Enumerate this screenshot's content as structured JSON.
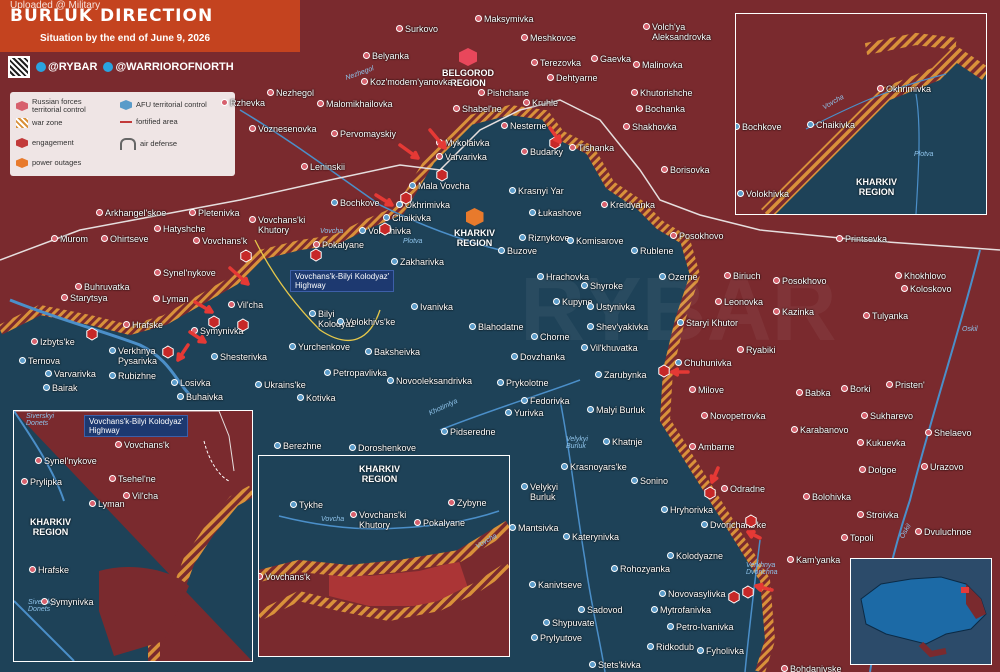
{
  "header": {
    "uploaded": "Uploaded @ Military",
    "title": "BURLUK DIRECTION",
    "subtitle": "Situation by the end of June 9, 2026",
    "handle1": "@RYBAR",
    "handle2": "@WARRIOROFNORTH"
  },
  "legend": {
    "ru_control": "Russian forces territorial control",
    "afu_control": "AFU territorial control",
    "war_zone": "war zone",
    "fortified": "fortified area",
    "engagement": "engagement",
    "air_defense": "air defense",
    "power": "power outages"
  },
  "regions": {
    "belgorod": "BELGOROD\nREGION",
    "kharkiv_main": "KHARKIV\nREGION",
    "kharkiv_inset_tr": "KHARKIV\nREGION",
    "kharkiv_inset_bl": "KHARKIV\nREGION",
    "kharkiv_inset_bm": "KHARKIV\nREGION"
  },
  "callouts": {
    "highway_main_1": "Vovchans'k-Bilyi Kolodyaz'",
    "highway_main_2": "Highway",
    "highway_inset_1": "Vovchans'k-Bilyi Kolodyaz'",
    "highway_inset_2": "Highway"
  },
  "rivers": {
    "nezhegol": "Nezhegol",
    "vovcha_main": "Vovcha",
    "plotva_main": "Plotva",
    "khotimlya": "Khotimlya",
    "velykyi_burluk_r": "Velykyi\nBurluk",
    "oskil": "Oskil",
    "oskil2": "Oskil",
    "verkhnya": "Verkhnya\nDvorichna",
    "siverskyi1": "Siverskyi\nDonets",
    "siverskyi2": "Siverskyi\nDonets",
    "vovcha_tr": "Vovcha",
    "plotva_tr": "Plotva",
    "vovcha_bm": "Vovcha",
    "vovcha_bm2": "Vovcha"
  },
  "towns_ru": [
    {
      "id": "surkovo",
      "name": "Surkovo"
    },
    {
      "id": "maksymivka",
      "name": "Maksymivka"
    },
    {
      "id": "meshkovoe",
      "name": "Meshkovoe"
    },
    {
      "id": "volchya",
      "name": "Volch'ya\nAleksandrovka"
    },
    {
      "id": "belyanka",
      "name": "Belyanka"
    },
    {
      "id": "terezovka",
      "name": "Terezovka"
    },
    {
      "id": "gaevka",
      "name": "Gaevka"
    },
    {
      "id": "malinovka",
      "name": "Malinovka"
    },
    {
      "id": "kozmod",
      "name": "Koz'modem'yanovka"
    },
    {
      "id": "dehtyarne",
      "name": "Dehtyarne"
    },
    {
      "id": "nezhegol_t",
      "name": "Nezhegol"
    },
    {
      "id": "malomikh",
      "name": "Malomikhailovka"
    },
    {
      "id": "pishchane",
      "name": "Pishchane"
    },
    {
      "id": "khutor",
      "name": "Khutorishche"
    },
    {
      "id": "rzhevka",
      "name": "Rzhevka"
    },
    {
      "id": "shabelne",
      "name": "Shabel'ne"
    },
    {
      "id": "kruhle",
      "name": "Kruhle"
    },
    {
      "id": "bochanka",
      "name": "Bochanka"
    },
    {
      "id": "voznes",
      "name": "Voznesenovka"
    },
    {
      "id": "shakhovka",
      "name": "Shakhovka"
    },
    {
      "id": "pervom",
      "name": "Pervomayskiy"
    },
    {
      "id": "mykolaivka",
      "name": "Mykolaivka"
    },
    {
      "id": "nesterne",
      "name": "Nesterne"
    },
    {
      "id": "varvarivka",
      "name": "Varvarivka"
    },
    {
      "id": "budarky",
      "name": "Budarky"
    },
    {
      "id": "tishanka",
      "name": "Tishanka"
    },
    {
      "id": "leninskii",
      "name": "Leninskii"
    },
    {
      "id": "borisovka",
      "name": "Borisovka"
    },
    {
      "id": "kreidyanka",
      "name": "Kreidyanka"
    },
    {
      "id": "arkhangel",
      "name": "Arkhangel'skoe"
    },
    {
      "id": "pletenivka",
      "name": "Pletenivka"
    },
    {
      "id": "hatyshche",
      "name": "Hatyshche"
    },
    {
      "id": "murom",
      "name": "Murom"
    },
    {
      "id": "ohirtseve",
      "name": "Ohirtseve"
    },
    {
      "id": "vovchansk",
      "name": "Vovchans'k"
    },
    {
      "id": "vovkhut",
      "name": "Vovchans'ki\nKhutory"
    },
    {
      "id": "pokalyane",
      "name": "Pokalyane"
    },
    {
      "id": "posokhovo1",
      "name": "Posokhovo"
    },
    {
      "id": "printsevka",
      "name": "Printsevka"
    },
    {
      "id": "synelnykove",
      "name": "Synel'nykove"
    },
    {
      "id": "buhruvatka",
      "name": "Buhruvatka"
    },
    {
      "id": "starytsya",
      "name": "Starytsya"
    },
    {
      "id": "lyman",
      "name": "Lyman"
    },
    {
      "id": "vilcha",
      "name": "Vil'cha"
    },
    {
      "id": "biriuch",
      "name": "Biriuch"
    },
    {
      "id": "posokhovo2",
      "name": "Posokhovo"
    },
    {
      "id": "khokhlovo",
      "name": "Khokhlovo"
    },
    {
      "id": "koloskovo",
      "name": "Koloskovo"
    },
    {
      "id": "leonovka",
      "name": "Leonovka"
    },
    {
      "id": "kazinka",
      "name": "Kazinka"
    },
    {
      "id": "tulyanka",
      "name": "Tulyanka"
    },
    {
      "id": "hrafske",
      "name": "Hrafske"
    },
    {
      "id": "symynivka",
      "name": "Symynivka"
    },
    {
      "id": "izbytske",
      "name": "Izbyts'ke"
    },
    {
      "id": "ryabiki",
      "name": "Ryabiki"
    },
    {
      "id": "babka",
      "name": "Babka"
    },
    {
      "id": "borki",
      "name": "Borki"
    },
    {
      "id": "pristen",
      "name": "Pristen'"
    },
    {
      "id": "sukharevo",
      "name": "Sukharevo"
    },
    {
      "id": "karabanovo",
      "name": "Karabanovo"
    },
    {
      "id": "shelaevo",
      "name": "Shelaevo"
    },
    {
      "id": "kukuevka",
      "name": "Kukuevka"
    },
    {
      "id": "dolgoe",
      "name": "Dolgoe"
    },
    {
      "id": "urazovo",
      "name": "Urazovo"
    },
    {
      "id": "bolohivka",
      "name": "Bolohivka"
    },
    {
      "id": "stroivka",
      "name": "Stroivka"
    },
    {
      "id": "dvuluchnoe",
      "name": "Dvuluchnoe"
    },
    {
      "id": "topoli",
      "name": "Topoli"
    },
    {
      "id": "kamyanka",
      "name": "Kam'yanka"
    },
    {
      "id": "bohdanivske",
      "name": "Bohdanivske"
    },
    {
      "id": "milove",
      "name": "Milove"
    },
    {
      "id": "novopetrovka",
      "name": "Novopetrovka"
    },
    {
      "id": "ambarne",
      "name": "Ambarne"
    },
    {
      "id": "odradne",
      "name": "Odradne"
    },
    {
      "id": "okhrimivka_tr",
      "name": "Okhrimivka"
    }
  ],
  "towns_ua": [
    {
      "id": "mala_vovcha",
      "name": "Mala Vovcha"
    },
    {
      "id": "krasnyi_yar",
      "name": "Krasnyi Yar"
    },
    {
      "id": "bochkove",
      "name": "Bochkove"
    },
    {
      "id": "okhrimivka",
      "name": "Okhrimivka"
    },
    {
      "id": "chaikivka",
      "name": "Chaikivka"
    },
    {
      "id": "volokhivka",
      "name": "Volokhivka"
    },
    {
      "id": "lukashove",
      "name": "Łukashove"
    },
    {
      "id": "riznykove",
      "name": "Riznykove"
    },
    {
      "id": "komisarove",
      "name": "Komisarove"
    },
    {
      "id": "rublene",
      "name": "Rublene"
    },
    {
      "id": "zakharivka",
      "name": "Zakharivka"
    },
    {
      "id": "buzove",
      "name": "Buzove"
    },
    {
      "id": "hrachovka",
      "name": "Hrachovka"
    },
    {
      "id": "ozerne",
      "name": "Ozerne"
    },
    {
      "id": "shyroke",
      "name": "Shyroke"
    },
    {
      "id": "kupyne",
      "name": "Kupyne"
    },
    {
      "id": "ustynivka",
      "name": "Ustynivka"
    },
    {
      "id": "staryi_khutor",
      "name": "Staryi Khutor"
    },
    {
      "id": "ivanivka",
      "name": "Ivanivka"
    },
    {
      "id": "bilyi",
      "name": "Bilyi\nKolodyaz'"
    },
    {
      "id": "volokhivske",
      "name": "Volokhivs'ke"
    },
    {
      "id": "blahodatne",
      "name": "Blahodatne"
    },
    {
      "id": "chorne",
      "name": "Chorne"
    },
    {
      "id": "shevyakivka",
      "name": "Shev'yakivka"
    },
    {
      "id": "vilkhuvatka",
      "name": "Vil'khuvatka"
    },
    {
      "id": "chuhunivka",
      "name": "Chuhunivka"
    },
    {
      "id": "yurchenkove",
      "name": "Yurchenkove"
    },
    {
      "id": "baksheivka",
      "name": "Baksheivka"
    },
    {
      "id": "dovzhanka",
      "name": "Dovzhanka"
    },
    {
      "id": "zarubynka",
      "name": "Zarubynka"
    },
    {
      "id": "shesterivka",
      "name": "Shesterivka"
    },
    {
      "id": "petropavlivka",
      "name": "Petropavlivka"
    },
    {
      "id": "novooleks",
      "name": "Novooleksandrivka"
    },
    {
      "id": "prykolotne",
      "name": "Prykolotne"
    },
    {
      "id": "verkhnya_pys",
      "name": "Verkhnya\nPysarivka"
    },
    {
      "id": "ternova",
      "name": "Ternova"
    },
    {
      "id": "varvarivka2",
      "name": "Varvarivka"
    },
    {
      "id": "bairak",
      "name": "Bairak"
    },
    {
      "id": "rubizhne",
      "name": "Rubizhne"
    },
    {
      "id": "losivka",
      "name": "Losivka"
    },
    {
      "id": "buhaivka",
      "name": "Buhaivka"
    },
    {
      "id": "ukrainske",
      "name": "Ukrains'ke"
    },
    {
      "id": "kotivka",
      "name": "Kotivka"
    },
    {
      "id": "fedorivka",
      "name": "Fedorivka"
    },
    {
      "id": "yurivka",
      "name": "Yurivka"
    },
    {
      "id": "malyi_burluk",
      "name": "Malyi Burluk"
    },
    {
      "id": "pidseredne",
      "name": "Pidseredne"
    },
    {
      "id": "khatnje",
      "name": "Khatnje"
    },
    {
      "id": "berezhne",
      "name": "Berezhne"
    },
    {
      "id": "doroshenkove",
      "name": "Doroshenkove"
    },
    {
      "id": "krasnoyarske",
      "name": "Krasnoyars'ke"
    },
    {
      "id": "sonino",
      "name": "Sonino"
    },
    {
      "id": "velykyi_burluk",
      "name": "Velykyi\nBurluk"
    },
    {
      "id": "hryhorivka",
      "name": "Hryhorivka"
    },
    {
      "id": "dvorichanske",
      "name": "Dvorichans'ke"
    },
    {
      "id": "mantsivka",
      "name": "Mantsivka"
    },
    {
      "id": "katerynivka",
      "name": "Katerynivka"
    },
    {
      "id": "kolodyazne",
      "name": "Kolodyazne"
    },
    {
      "id": "kanivtseve",
      "name": "Kanivtseve"
    },
    {
      "id": "rohozyanka",
      "name": "Rohozyanka"
    },
    {
      "id": "novovasylivka",
      "name": "Novovasylivka"
    },
    {
      "id": "sadovod",
      "name": "Sadovod"
    },
    {
      "id": "mytrofanivka",
      "name": "Mytrofanivka"
    },
    {
      "id": "shypuvate",
      "name": "Shypuvate"
    },
    {
      "id": "petro_ivan",
      "name": "Petro-Ivanivka"
    },
    {
      "id": "prylyutove",
      "name": "Prylyutove"
    },
    {
      "id": "ridkodub",
      "name": "Ridkodub"
    },
    {
      "id": "fyholivka",
      "name": "Fyholivka"
    },
    {
      "id": "stets",
      "name": "Stets'kivka"
    }
  ],
  "inset_tr_towns": [
    {
      "id": "tr_bochkove",
      "name": "Bochkove"
    },
    {
      "id": "tr_chaikivka",
      "name": "Chaikivka"
    },
    {
      "id": "tr_volokhivka",
      "name": "Volokhivka"
    }
  ],
  "inset_bl_towns": [
    {
      "id": "bl_vovchansk",
      "name": "Vovchans'k"
    },
    {
      "id": "bl_synel",
      "name": "Synel'nykove"
    },
    {
      "id": "bl_tsehel",
      "name": "Tsehel'ne"
    },
    {
      "id": "bl_prylipka",
      "name": "Prylipka"
    },
    {
      "id": "bl_vilcha",
      "name": "Vil'cha"
    },
    {
      "id": "bl_lyman",
      "name": "Lyman"
    },
    {
      "id": "bl_hrafske",
      "name": "Hrafske"
    },
    {
      "id": "bl_symynivka",
      "name": "Symynivka"
    }
  ],
  "inset_bm_towns": [
    {
      "id": "bm_tykhe",
      "name": "Tykhe"
    },
    {
      "id": "bm_zybyne",
      "name": "Zybyne"
    },
    {
      "id": "bm_vovkhut",
      "name": "Vovchans'ki\nKhutory"
    },
    {
      "id": "bm_pokalyane",
      "name": "Pokalyane"
    },
    {
      "id": "bm_vovchansk",
      "name": "Vovchans'k"
    }
  ],
  "colors": {
    "ru": "#7a2a2e",
    "ua": "#1e4258",
    "war_zone": "#d9913a",
    "accent": "#e04236",
    "header": "#c4431f"
  }
}
